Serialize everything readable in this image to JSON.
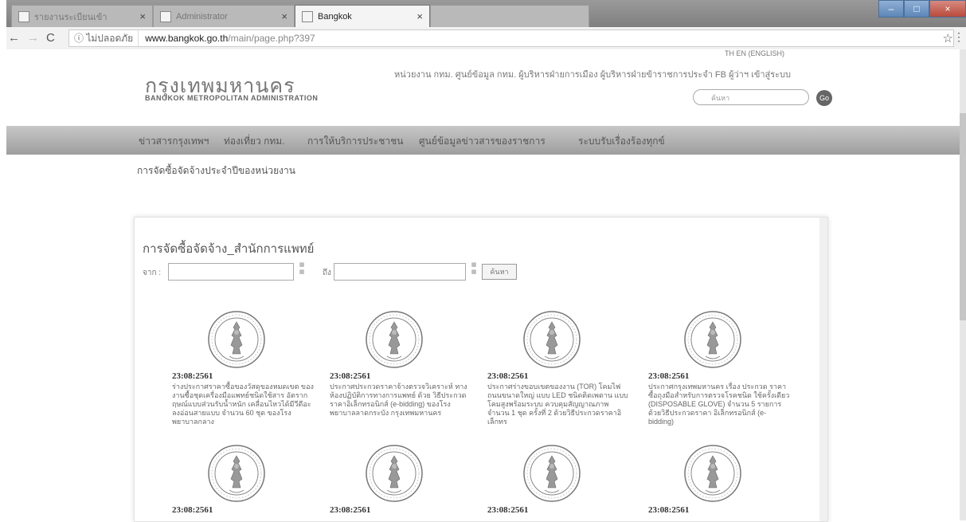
{
  "browser": {
    "tabs": [
      {
        "label": "รายงานระเบียนเข้า"
      },
      {
        "label": "Administrator"
      },
      {
        "label": "Bangkok"
      }
    ],
    "address": {
      "info": "ไม่ปลอดภัย",
      "host": "www.bangkok.go.th",
      "path": "/main/page.php?397"
    }
  },
  "header": {
    "lang": "TH  EN  (ENGLISH)",
    "logo_th": "กรุงเทพมหานคร",
    "logo_en": "BANGKOK METROPOLITAN ADMINISTRATION",
    "top_links": "หน่วยงาน กทม.  ศูนย์ข้อมูล กทม.  ผู้บริหารฝ่ายการเมือง  ผู้บริหารฝ่ายข้าราชการประจำ  FB ผู้ว่าฯ  เข้าสู่ระบบ",
    "search_placeholder": "ค้นหา",
    "go_label": "Go"
  },
  "nav": {
    "items": [
      {
        "label": "ข่าวสารกรุงเทพฯ"
      },
      {
        "label": "ท่องเที่ยว กทม."
      },
      {
        "label": "การให้บริการประชาชน"
      },
      {
        "label": "ศูนย์ข้อมูลข่าวสารของราชการ"
      },
      {
        "label": "ระบบรับเรื่องร้องทุกข์"
      }
    ],
    "sub": "การจัดซื้อจัดจ้างประจำปีของหน่วยงาน"
  },
  "content": {
    "title": "การจัดซื้อจัดจ้าง_สำนักการแพทย์",
    "from_label": "จาก :",
    "to_label": "ถึง :",
    "search_label": "ค้นหา",
    "cards": [
      {
        "date": "23:08:2561",
        "desc": "ร่างประกาศราคาซื้อของวัสดุของหมดเขต ของงานซื้อชุดเครื่องมือแพทย์ชนิดใช้สาร อัตรากฤษณ์แบบส่วนรับน้ำหนัก เคลื่อนไหวได้มีวีดีอะลงอ่อนสายแบบ จำนวน 60 ชุด ของโรงพยาบาลกลาง"
      },
      {
        "date": "23:08:2561",
        "desc": "ประกาศประกวดราคาจ้างตรวจวิเคราะห์ ทางห้องปฏิบัติการทางการแพทย์ ด้วย วิธีประกวดราคาอิเล็กทรอนิกส์ (e-bidding) ของโรงพยาบาลลาดกระบัง กรุงเทพมหานคร"
      },
      {
        "date": "23:08:2561",
        "desc": "ประกาศร่างขอบเขตของงาน (TOR) โคมไฟถนนขนาดใหญ่ แบบ LED ชนิดติดเพดาน แบบโคมสูงพร้อมระบบ ควบคุมสัญญาณภาพ จำนวน 1 ชุด ครั้งที่ 2 ด้วยวิธีประกวดราคาอิเล็กทร"
      },
      {
        "date": "23:08:2561",
        "desc": "ประกาศกรุงเทพมหานคร เรื่อง ประกวด ราคาซื้อถุงมือสำหรับการตรวจโรคชนิด ใช้ครั้งเดียว (DISPOSABLE GLOVE) จำนวน 5 รายการ ด้วยวิธีประกวดราคา อิเล็กทรอนิกส์ (e-bidding)"
      },
      {
        "date": "23:08:2561",
        "desc": ""
      },
      {
        "date": "23:08:2561",
        "desc": ""
      },
      {
        "date": "23:08:2561",
        "desc": ""
      },
      {
        "date": "23:08:2561",
        "desc": ""
      }
    ]
  }
}
